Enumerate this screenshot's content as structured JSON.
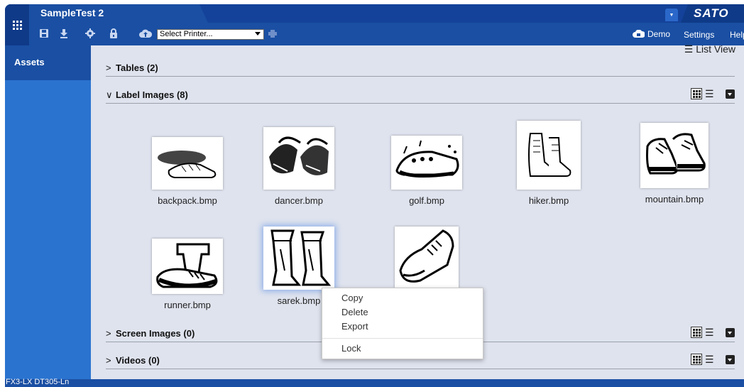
{
  "app": {
    "title": "SampleTest 2",
    "logo_text": "SATO",
    "printer_select": "Select Printer...",
    "demo_label": "Demo",
    "settings_label": "Settings",
    "help_label": "Help"
  },
  "sidebar": {
    "items": [
      {
        "label": "Assets"
      }
    ]
  },
  "status": {
    "text": "FX3-LX DT305-Ln"
  },
  "content": {
    "list_view_label": "☰ List View",
    "sections": [
      {
        "title": "Tables  (2)",
        "expanded": false
      },
      {
        "title": "Label Images  (8)",
        "expanded": true
      },
      {
        "title": "Screen Images  (0)",
        "expanded": false
      },
      {
        "title": "Videos  (0)",
        "expanded": false
      }
    ],
    "images": [
      {
        "name": "backpack.bmp",
        "icon": "sneaker-image"
      },
      {
        "name": "dancer.bmp",
        "icon": "dance-shoes-image"
      },
      {
        "name": "golf.bmp",
        "icon": "golf-shoe-image"
      },
      {
        "name": "hiker.bmp",
        "icon": "hiking-boots-image"
      },
      {
        "name": "mountain.bmp",
        "icon": "mountain-boots-image"
      },
      {
        "name": "runner.bmp",
        "icon": "running-shoe-image"
      },
      {
        "name": "sarek.bmp",
        "icon": "tall-boots-image"
      },
      {
        "name": "",
        "icon": "dress-shoe-image"
      }
    ]
  },
  "context_menu": {
    "items": [
      "Copy",
      "Delete",
      "Export",
      "Lock"
    ]
  },
  "colors": {
    "topbar": "#1a4fa3",
    "sidebar": "#2a73cf",
    "content_bg": "#dfe3ee"
  }
}
